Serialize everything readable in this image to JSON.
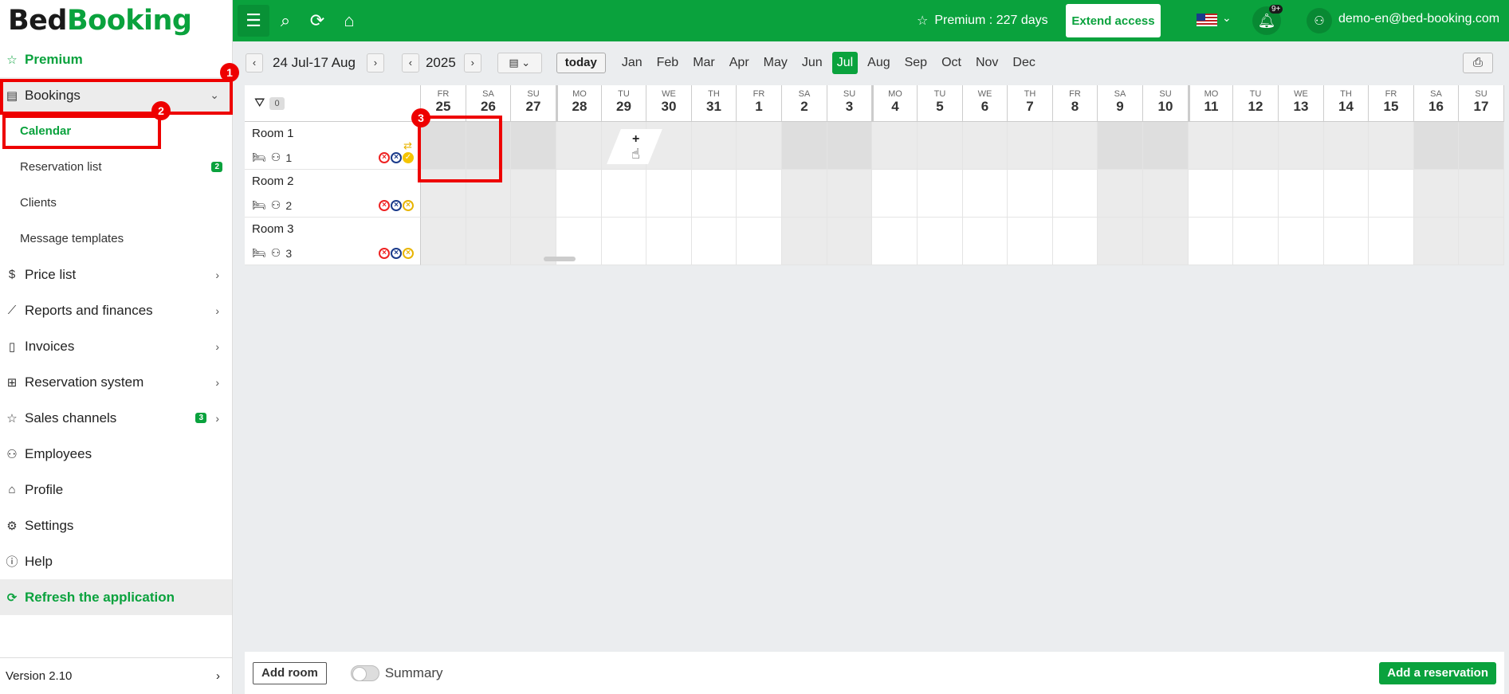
{
  "logo": {
    "bed": "Bed",
    "booking": "Booking"
  },
  "sidebar": {
    "premium": "Premium",
    "bookings": "Bookings",
    "sub_items": [
      {
        "label": "Calendar"
      },
      {
        "label": "Reservation list",
        "badge": "2"
      },
      {
        "label": "Clients"
      },
      {
        "label": "Message templates"
      }
    ],
    "items": [
      {
        "label": "Price list"
      },
      {
        "label": "Reports and finances"
      },
      {
        "label": "Invoices"
      },
      {
        "label": "Reservation system"
      },
      {
        "label": "Sales channels",
        "badge": "3"
      },
      {
        "label": "Employees"
      },
      {
        "label": "Profile"
      },
      {
        "label": "Settings"
      },
      {
        "label": "Help"
      }
    ],
    "refresh": "Refresh the application",
    "version": "Version 2.10"
  },
  "topbar": {
    "premium_text": "Premium : 227 days",
    "extend": "Extend access",
    "notif_badge": "9+",
    "user_email": "demo-en@bed-booking.com"
  },
  "toolbar": {
    "range": "24 Jul-17 Aug",
    "year": "2025",
    "today": "today",
    "months": [
      "Jan",
      "Feb",
      "Mar",
      "Apr",
      "May",
      "Jun",
      "Jul",
      "Aug",
      "Sep",
      "Oct",
      "Nov",
      "Dec"
    ],
    "active_month": "Jul"
  },
  "calendar": {
    "filter_count": "0",
    "rooms": [
      {
        "name": "Room 1",
        "capacity": "1"
      },
      {
        "name": "Room 2",
        "capacity": "2"
      },
      {
        "name": "Room 3",
        "capacity": "3"
      }
    ],
    "days": [
      {
        "dn": "FR",
        "dd": "25"
      },
      {
        "dn": "SA",
        "dd": "26"
      },
      {
        "dn": "SU",
        "dd": "27"
      },
      {
        "dn": "MO",
        "dd": "28"
      },
      {
        "dn": "TU",
        "dd": "29"
      },
      {
        "dn": "WE",
        "dd": "30"
      },
      {
        "dn": "TH",
        "dd": "31"
      },
      {
        "dn": "FR",
        "dd": "1"
      },
      {
        "dn": "SA",
        "dd": "2"
      },
      {
        "dn": "SU",
        "dd": "3"
      },
      {
        "dn": "MO",
        "dd": "4"
      },
      {
        "dn": "TU",
        "dd": "5"
      },
      {
        "dn": "WE",
        "dd": "6"
      },
      {
        "dn": "TH",
        "dd": "7"
      },
      {
        "dn": "FR",
        "dd": "8"
      },
      {
        "dn": "SA",
        "dd": "9"
      },
      {
        "dn": "SU",
        "dd": "10"
      },
      {
        "dn": "MO",
        "dd": "11"
      },
      {
        "dn": "TU",
        "dd": "12"
      },
      {
        "dn": "WE",
        "dd": "13"
      },
      {
        "dn": "TH",
        "dd": "14"
      },
      {
        "dn": "FR",
        "dd": "15"
      },
      {
        "dn": "SA",
        "dd": "16"
      },
      {
        "dn": "SU",
        "dd": "17"
      }
    ],
    "new_cell_symbol": "+"
  },
  "annotations": [
    "1",
    "2",
    "3"
  ],
  "bottombar": {
    "add_room": "Add room",
    "summary": "Summary",
    "add_reservation": "Add a reservation"
  },
  "colors": {
    "brand": "#0aa23d",
    "highlight": "#e00000"
  }
}
